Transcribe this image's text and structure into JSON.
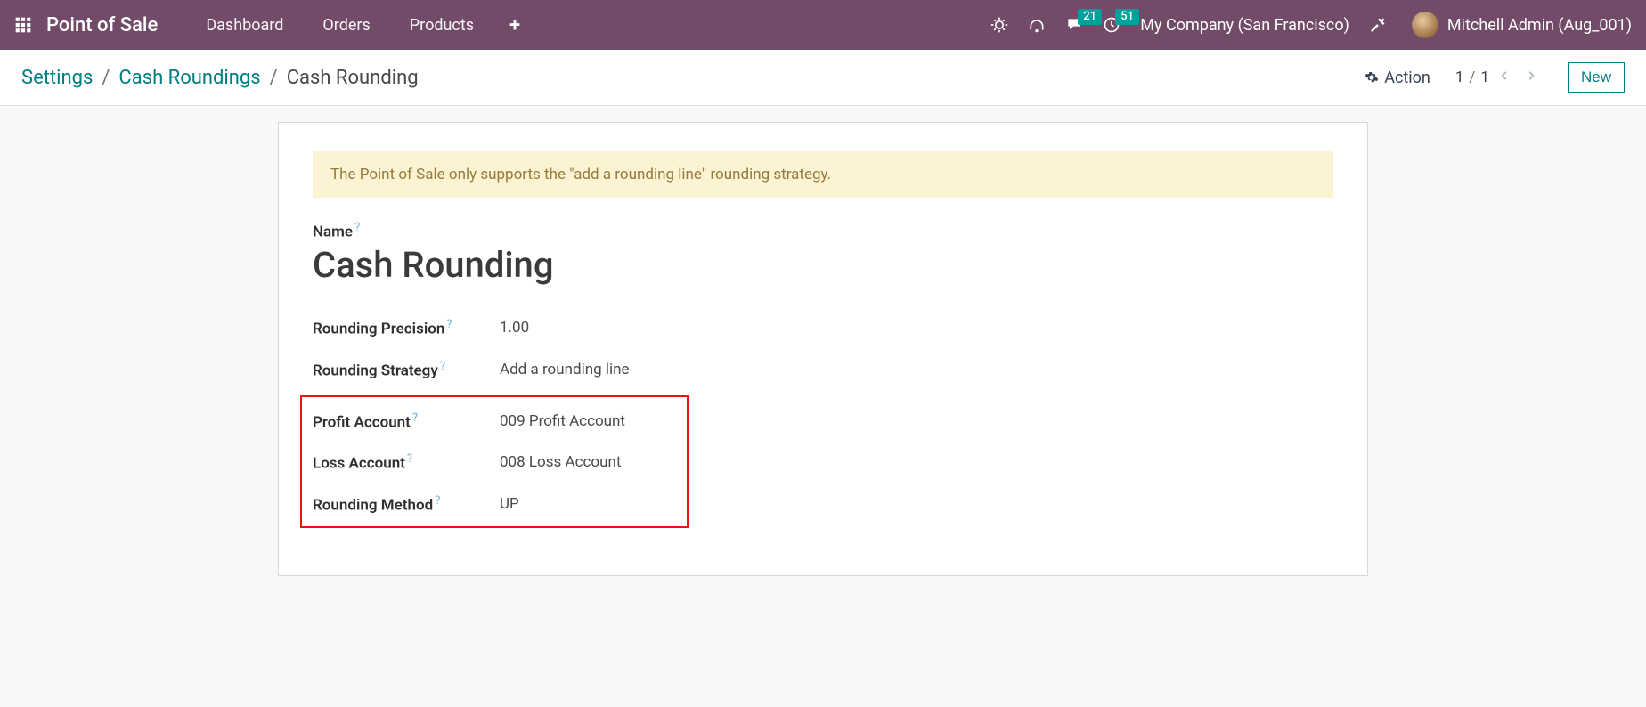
{
  "navbar": {
    "brand": "Point of Sale",
    "links": [
      "Dashboard",
      "Orders",
      "Products"
    ],
    "messaging_badge": "21",
    "activities_badge": "51",
    "company": "My Company (San Francisco)",
    "user": "Mitchell Admin (Aug_001)"
  },
  "control": {
    "crumbs": [
      "Settings",
      "Cash Roundings",
      "Cash Rounding"
    ],
    "action_label": "Action",
    "pager_current": "1",
    "pager_total": "1",
    "new_label": "New"
  },
  "form": {
    "alert": "The Point of Sale only supports the \"add a rounding line\" rounding strategy.",
    "name_label": "Name",
    "name_value": "Cash Rounding",
    "rows": [
      {
        "label": "Rounding Precision",
        "value": "1.00"
      },
      {
        "label": "Rounding Strategy",
        "value": "Add a rounding line"
      }
    ],
    "highlight_rows": [
      {
        "label": "Profit Account",
        "value": "009 Profit Account"
      },
      {
        "label": "Loss Account",
        "value": "008 Loss Account"
      },
      {
        "label": "Rounding Method",
        "value": "UP"
      }
    ]
  }
}
